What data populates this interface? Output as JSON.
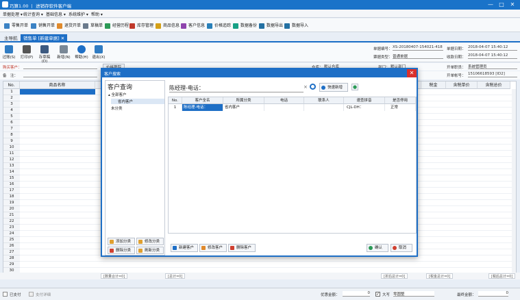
{
  "window": {
    "title": "巧算1.00 丨 进销存软件客户端",
    "controls": [
      "—",
      "□",
      "✕"
    ]
  },
  "menu": [
    "单据处理 ▾",
    "统计查询 ▾",
    "基础信息 ▾",
    "系统维护 ▾",
    "帮助 ▾"
  ],
  "toolbar": [
    "零售开单",
    "销售开单",
    "退货开单",
    "草稿单",
    "经营历程",
    "库存管理",
    "商品信息",
    "客户信息",
    "价格追踪",
    "数据备份",
    "数据导出",
    "数据导入"
  ],
  "tabs": {
    "home": "主导航",
    "active": "销售单 [新建单据]",
    "close": "✕"
  },
  "subbar": {
    "buttons": [
      "过账(S)",
      "打印(P)",
      "存草稿(D)",
      "新增(N)",
      "帮助(H)",
      "退出(X)"
    ],
    "bill_no_label": "单据编号：",
    "bill_no": "XS-20180407-154021-418",
    "date_label": "单据日期：",
    "date": "2018-04-07 15:40:12",
    "bill_type_label": "票据类型：",
    "bill_type": "普通单据",
    "pay_date_label": "收款日期：",
    "pay_date": "2018-04-07 15:40:12",
    "handler_label": "开单职员：",
    "handler": "系统管理员",
    "account_label": "开单帐号：",
    "account": "15106618593 [ID2]"
  },
  "customer_label": "购买客户：",
  "remark_label": "备　注：",
  "warehouse_label": "仓库：",
  "warehouse": "默认仓库",
  "dept_label": "部门：",
  "dept": "默认部门",
  "price_tab": "价格跟踪",
  "grid": {
    "headers": [
      "No.",
      "商品名称",
      "税金",
      "含税单价",
      "含税总价"
    ],
    "rows": [
      "1",
      "2",
      "3",
      "4",
      "5",
      "6",
      "7",
      "8",
      "9",
      "10",
      "11",
      "12",
      "13",
      "14",
      "15",
      "16",
      "17",
      "18",
      "19",
      "20",
      "21",
      "22",
      "23",
      "24",
      "25",
      "26",
      "27",
      "28",
      "29",
      "30"
    ]
  },
  "footer": [
    "[数量合计=0]",
    "[总计=0]",
    "[折后总计=0]",
    "[税金总计=0]",
    "[税后总计=0]"
  ],
  "status": {
    "paid": "已支付",
    "pay_detail": "支付详细",
    "discount_label": "优惠金额：",
    "discount": "0",
    "uppercase_label": "大写",
    "uppercase": "零圆整",
    "final_label": "最终金额：",
    "final": "0"
  },
  "dialog": {
    "title": "客户搜索",
    "close": "✕",
    "heading": "客户查询",
    "tree": [
      "全部客户",
      "省内客户",
      "未分类"
    ],
    "left_buttons": [
      "添加分类",
      "修改分类",
      "删除分类",
      "刷新分类"
    ],
    "search_value": "陈经理-电话：",
    "quick_add": "快速新增",
    "columns": [
      "No.",
      "客户全名",
      "所属分类",
      "电话",
      "联系人",
      "速查拼音",
      "是否停用"
    ],
    "rows": [
      {
        "no": "1",
        "name": "陈经理-电话：",
        "category": "省内客户",
        "phone": "",
        "contact": "",
        "pinyin": "CJL-DH：",
        "status": "正常"
      }
    ],
    "bottom_buttons": [
      "新建客户",
      "修改客户",
      "删除客户"
    ],
    "ok": "确认",
    "cancel": "取消"
  }
}
